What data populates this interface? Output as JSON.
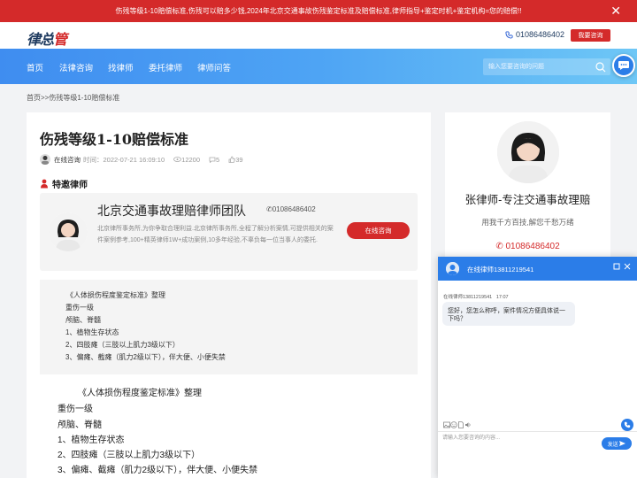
{
  "banner": {
    "text": "伤残等级1-10赔偿标准,伤残可以赔多少钱,2024年北京交通事故伤残鉴定标准及赔偿标准,律师指导+鉴定时机+鉴定机构=您的赔偿!!",
    "close": "✕"
  },
  "header": {
    "logo_main": "律总",
    "logo_accent": "管",
    "phone": "01086486402",
    "consult_button": "我要咨询"
  },
  "nav": {
    "items": [
      "首页",
      "法律咨询",
      "找律师",
      "委托律师",
      "律师问答"
    ],
    "search_placeholder": "输入您要咨询的问题"
  },
  "breadcrumb": {
    "home": "首页",
    "sep": ">>",
    "current": "伤残等级1-10赔偿标准"
  },
  "article": {
    "title": "伤残等级1-10赔偿标准",
    "author": "在线咨询",
    "time_label": "时间：",
    "time": "2022-07-21 16:09:10",
    "views": "12200",
    "comments": "5",
    "likes": "39"
  },
  "invite": {
    "heading": "特邀律师",
    "firm": "北京交通事故理赔律师团队",
    "phone": "01086486402",
    "description": "北京律所事务所,为你争取合理利益.北京律所事务所,全程了解分析案情,可提供相关的案件案例参考,100+精英律师1W+成功案例,10多年经验,不辜负每一位当事人的委托.",
    "online_button": "在线咨询"
  },
  "quote_lines": [
    "《人体损伤程度鉴定标准》整理",
    "重伤一级",
    "颅脑、脊髓",
    "1、植物生存状态",
    "2、四肢瘫（三肢以上肌力3级以下）",
    "3、偏瘫、截瘫（肌力2级以下），伴大便、小便失禁"
  ],
  "body_lines": [
    "《人体损伤程度鉴定标准》整理",
    "重伤一级",
    "颅脑、脊髓",
    "1、植物生存状态",
    "2、四肢瘫（三肢以上肌力3级以下）",
    "3、偏瘫、截瘫（肌力2级以下），伴大便、小便失禁"
  ],
  "sidebar": {
    "name": "张律师-专注交通事故理赔",
    "slogan": "用我千方百技,解您千愁万绪",
    "phone": "01086486402"
  },
  "chat": {
    "title": "在线律师13811219541",
    "sender": "在线律师13811219541",
    "sent_time": "17:07",
    "message": "您好，您怎么称呼，案件情况方便具体说一下吗？",
    "input_placeholder": "请输入您要咨询的内容...",
    "send_button": "发送"
  },
  "colors": {
    "brand_red": "#d42a2a",
    "nav_blue": "#3f8df0",
    "chat_blue": "#2b7de8"
  }
}
